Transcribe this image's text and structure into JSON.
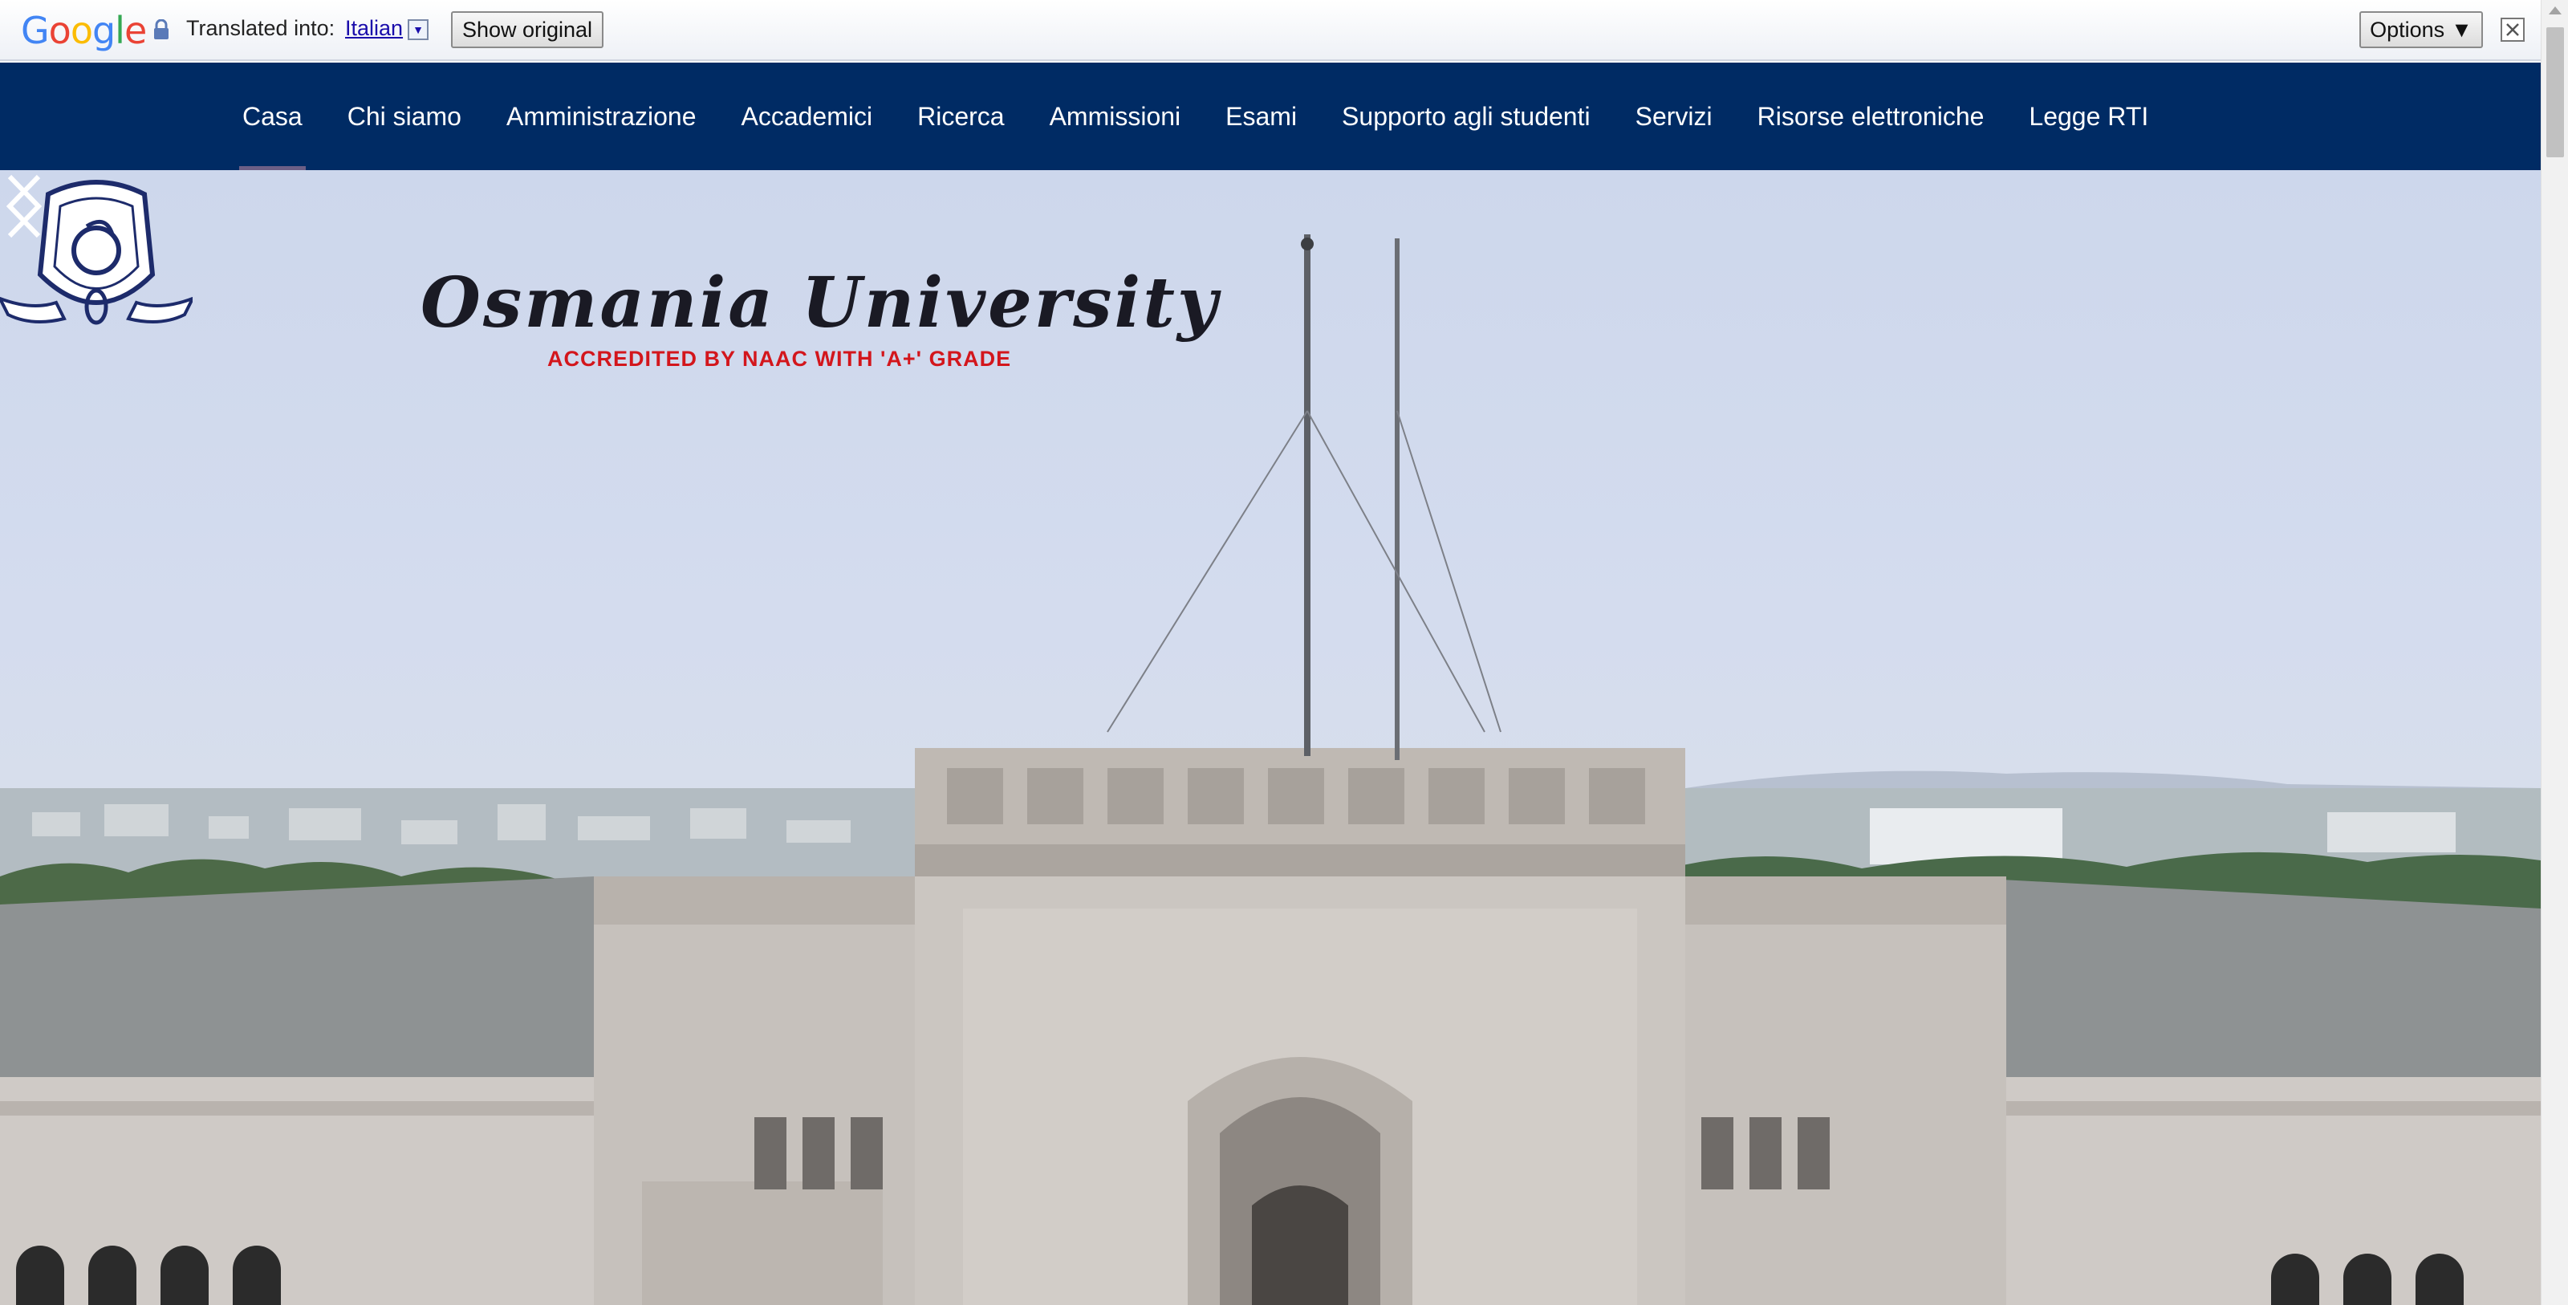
{
  "translate_bar": {
    "logo": "Google",
    "translated_label": "Translated into:",
    "language": "Italian",
    "show_original": "Show original",
    "options": "Options"
  },
  "nav": {
    "items": [
      {
        "label": "Casa",
        "active": true
      },
      {
        "label": "Chi siamo"
      },
      {
        "label": "Amministrazione"
      },
      {
        "label": "Accademici"
      },
      {
        "label": "Ricerca"
      },
      {
        "label": "Ammissioni"
      },
      {
        "label": "Esami"
      },
      {
        "label": "Supporto agli studenti"
      },
      {
        "label": "Servizi"
      },
      {
        "label": "Risorse elettroniche"
      },
      {
        "label": "Legge RTI"
      }
    ]
  },
  "hero": {
    "title": "Osmania University",
    "subtitle": "ACCREDITED BY NAAC WITH 'A+' GRADE",
    "logo_ring_text": "OSMANIA UNIVERSITY",
    "image": "university-building-photo"
  },
  "colors": {
    "nav_bg": "#002b64",
    "nav_text": "#ffffff",
    "active_underline": "#6c5f86",
    "subtitle_red": "#d3161c"
  }
}
